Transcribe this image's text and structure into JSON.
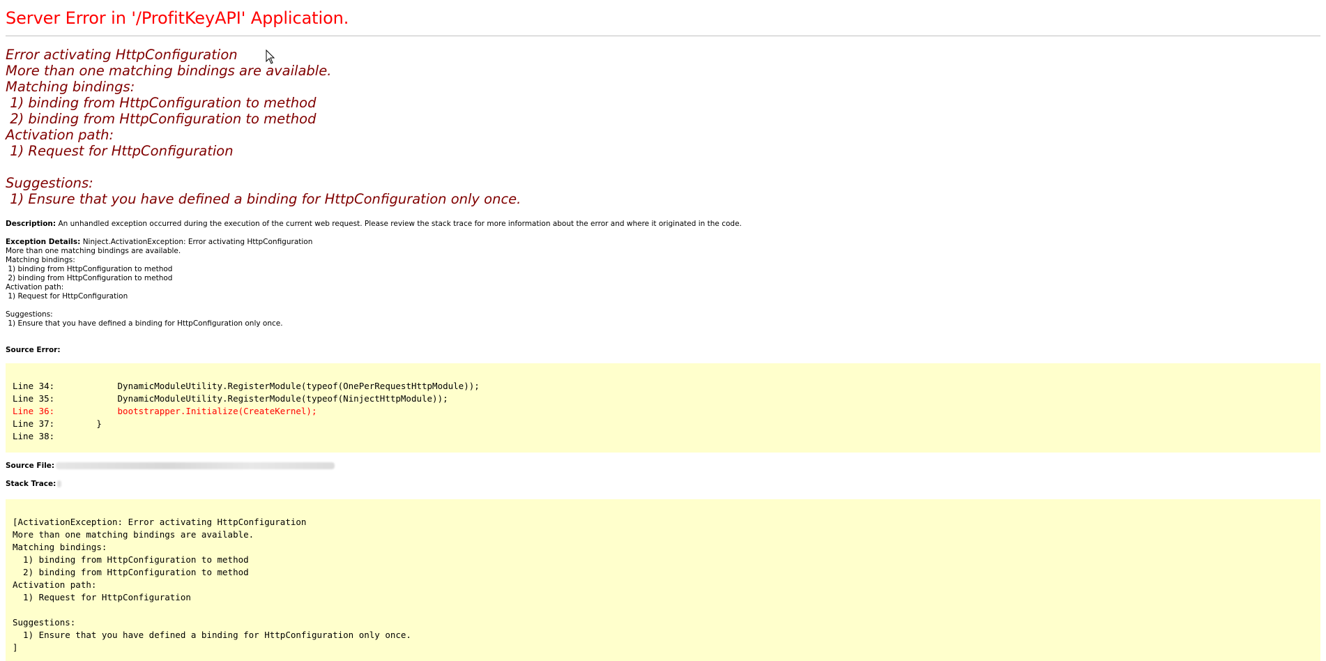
{
  "title": "Server Error in '/ProfitKeyAPI' Application.",
  "error_message": "Error activating HttpConfiguration\nMore than one matching bindings are available.\nMatching bindings:\n 1) binding from HttpConfiguration to method\n 2) binding from HttpConfiguration to method\nActivation path:\n 1) Request for HttpConfiguration\n\nSuggestions:\n 1) Ensure that you have defined a binding for HttpConfiguration only once.",
  "description": {
    "label": "Description:",
    "text": "An unhandled exception occurred during the execution of the current web request. Please review the stack trace for more information about the error and where it originated in the code."
  },
  "exception_details": {
    "label": "Exception Details:",
    "text": "Ninject.ActivationException: Error activating HttpConfiguration\nMore than one matching bindings are available.\nMatching bindings:\n 1) binding from HttpConfiguration to method\n 2) binding from HttpConfiguration to method\nActivation path:\n 1) Request for HttpConfiguration\n\nSuggestions:\n 1) Ensure that you have defined a binding for HttpConfiguration only once."
  },
  "source_error": {
    "label": "Source Error:",
    "lines": [
      {
        "text": "Line 34:            DynamicModuleUtility.RegisterModule(typeof(OnePerRequestHttpModule));",
        "highlight": false
      },
      {
        "text": "Line 35:            DynamicModuleUtility.RegisterModule(typeof(NinjectHttpModule));",
        "highlight": false
      },
      {
        "text": "Line 36:            bootstrapper.Initialize(CreateKernel);",
        "highlight": true
      },
      {
        "text": "Line 37:        }",
        "highlight": false
      },
      {
        "text": "Line 38:",
        "highlight": false
      }
    ]
  },
  "source_file": {
    "label": "Source File:"
  },
  "stack_trace": {
    "label": "Stack Trace:",
    "lines": [
      "[ActivationException: Error activating HttpConfiguration",
      "More than one matching bindings are available.",
      "Matching bindings:",
      "  1) binding from HttpConfiguration to method",
      "  2) binding from HttpConfiguration to method",
      "Activation path:",
      "  1) Request for HttpConfiguration",
      "",
      "Suggestions:",
      "  1) Ensure that you have defined a binding for HttpConfiguration only once.",
      "]"
    ]
  },
  "colors": {
    "title": "#ff0000",
    "error_message": "#800000",
    "code_background": "#ffffcc",
    "highlight_line": "#ff0000",
    "rule": "#c0c0c0"
  }
}
